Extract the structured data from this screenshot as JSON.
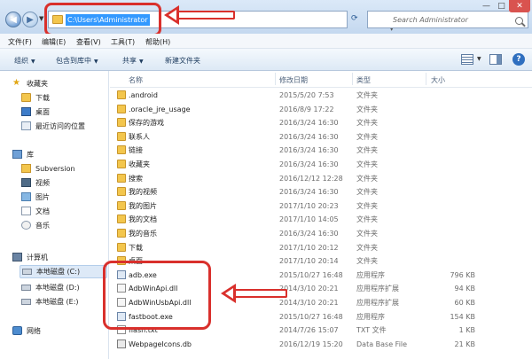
{
  "address": {
    "path": "C:\\Users\\Administrator"
  },
  "search": {
    "placeholder": "Search Administrator"
  },
  "window_controls": {
    "minimize": "—",
    "maximize": "□",
    "close": "✕"
  },
  "menu": [
    "文件(F)",
    "编辑(E)",
    "查看(V)",
    "工具(T)",
    "帮助(H)"
  ],
  "toolbar": {
    "organize": "组织",
    "include": "包含到库中",
    "share": "共享",
    "new_folder": "新建文件夹",
    "help": "?"
  },
  "nav": {
    "favorites": {
      "label": "收藏夹",
      "items": [
        "下载",
        "桌面",
        "最近访问的位置"
      ]
    },
    "library": {
      "label": "库",
      "items": [
        "Subversion",
        "视频",
        "图片",
        "文档",
        "音乐"
      ]
    },
    "computer": {
      "label": "计算机",
      "items": [
        "本地磁盘 (C:)",
        "本地磁盘 (D:)",
        "本地磁盘 (E:)"
      ]
    },
    "network": {
      "label": "网络"
    }
  },
  "columns": {
    "name": "名称",
    "date": "修改日期",
    "type": "类型",
    "size": "大小"
  },
  "files": [
    {
      "name": ".android",
      "date": "2015/5/20 7:53",
      "type": "文件夹",
      "size": "",
      "icon": "folder-icon"
    },
    {
      "name": ".oracle_jre_usage",
      "date": "2016/8/9 17:22",
      "type": "文件夹",
      "size": "",
      "icon": "folder-icon"
    },
    {
      "name": "保存的游戏",
      "date": "2016/3/24 16:30",
      "type": "文件夹",
      "size": "",
      "icon": "folder-icon"
    },
    {
      "name": "联系人",
      "date": "2016/3/24 16:30",
      "type": "文件夹",
      "size": "",
      "icon": "folder-icon"
    },
    {
      "name": "链接",
      "date": "2016/3/24 16:30",
      "type": "文件夹",
      "size": "",
      "icon": "folder-icon"
    },
    {
      "name": "收藏夹",
      "date": "2016/3/24 16:30",
      "type": "文件夹",
      "size": "",
      "icon": "folder-icon"
    },
    {
      "name": "搜索",
      "date": "2016/12/12 12:28",
      "type": "文件夹",
      "size": "",
      "icon": "folder-icon"
    },
    {
      "name": "我的视频",
      "date": "2016/3/24 16:30",
      "type": "文件夹",
      "size": "",
      "icon": "folder-icon"
    },
    {
      "name": "我的图片",
      "date": "2017/1/10 20:23",
      "type": "文件夹",
      "size": "",
      "icon": "folder-icon"
    },
    {
      "name": "我的文档",
      "date": "2017/1/10 14:05",
      "type": "文件夹",
      "size": "",
      "icon": "folder-icon"
    },
    {
      "name": "我的音乐",
      "date": "2016/3/24 16:30",
      "type": "文件夹",
      "size": "",
      "icon": "folder-icon"
    },
    {
      "name": "下载",
      "date": "2017/1/10 20:12",
      "type": "文件夹",
      "size": "",
      "icon": "folder-icon"
    },
    {
      "name": "桌面",
      "date": "2017/1/10 20:14",
      "type": "文件夹",
      "size": "",
      "icon": "folder-icon"
    },
    {
      "name": "adb.exe",
      "date": "2015/10/27 16:48",
      "type": "应用程序",
      "size": "796 KB",
      "icon": "exe-icon"
    },
    {
      "name": "AdbWinApi.dll",
      "date": "2014/3/10 20:21",
      "type": "应用程序扩展",
      "size": "94 KB",
      "icon": "dll-icon"
    },
    {
      "name": "AdbWinUsbApi.dll",
      "date": "2014/3/10 20:21",
      "type": "应用程序扩展",
      "size": "60 KB",
      "icon": "dll-icon"
    },
    {
      "name": "fastboot.exe",
      "date": "2015/10/27 16:48",
      "type": "应用程序",
      "size": "154 KB",
      "icon": "exe-icon"
    },
    {
      "name": "flash.txt",
      "date": "2014/7/26 15:07",
      "type": "TXT 文件",
      "size": "1 KB",
      "icon": "txt-icon"
    },
    {
      "name": "WebpageIcons.db",
      "date": "2016/12/19 15:20",
      "type": "Data Base File",
      "size": "21 KB",
      "icon": "db-icon"
    }
  ],
  "colors": {
    "annotation_red": "#d9302c",
    "selection_blue": "#3399ff"
  }
}
